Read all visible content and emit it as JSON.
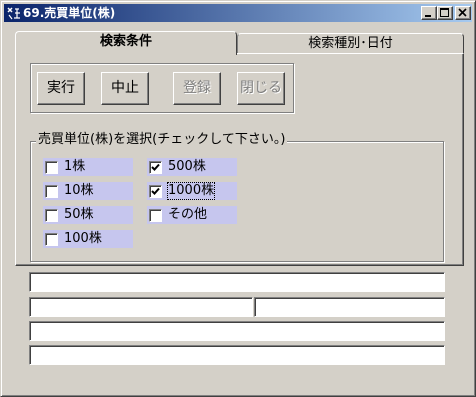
{
  "window": {
    "title": "69.売買単位(株)",
    "minimize_icon": "minimize-icon",
    "maximize_icon": "maximize-icon",
    "close_icon": "close-icon"
  },
  "tabs": [
    {
      "label": "検索条件",
      "active": true
    },
    {
      "label": "検索種別･日付",
      "active": false
    }
  ],
  "buttons": {
    "execute": "実行",
    "stop": "中止",
    "register": "登録",
    "close": "閉じる"
  },
  "unit_group": {
    "legend": "売買単位(株)を選択(チェックして下さい。)",
    "options": [
      {
        "label": "1株",
        "checked": false
      },
      {
        "label": "10株",
        "checked": false
      },
      {
        "label": "50株",
        "checked": false
      },
      {
        "label": "100株",
        "checked": false
      },
      {
        "label": "500株",
        "checked": true
      },
      {
        "label": "1000株",
        "checked": true
      },
      {
        "label": "その他",
        "checked": false
      }
    ]
  },
  "status_fields": [
    "",
    "",
    "",
    "",
    ""
  ],
  "colors": {
    "titlebar_start": "#0a246a",
    "titlebar_end": "#a6caf0",
    "checkbox_highlight": "#c6c6ee",
    "face": "#d4d0c8"
  }
}
